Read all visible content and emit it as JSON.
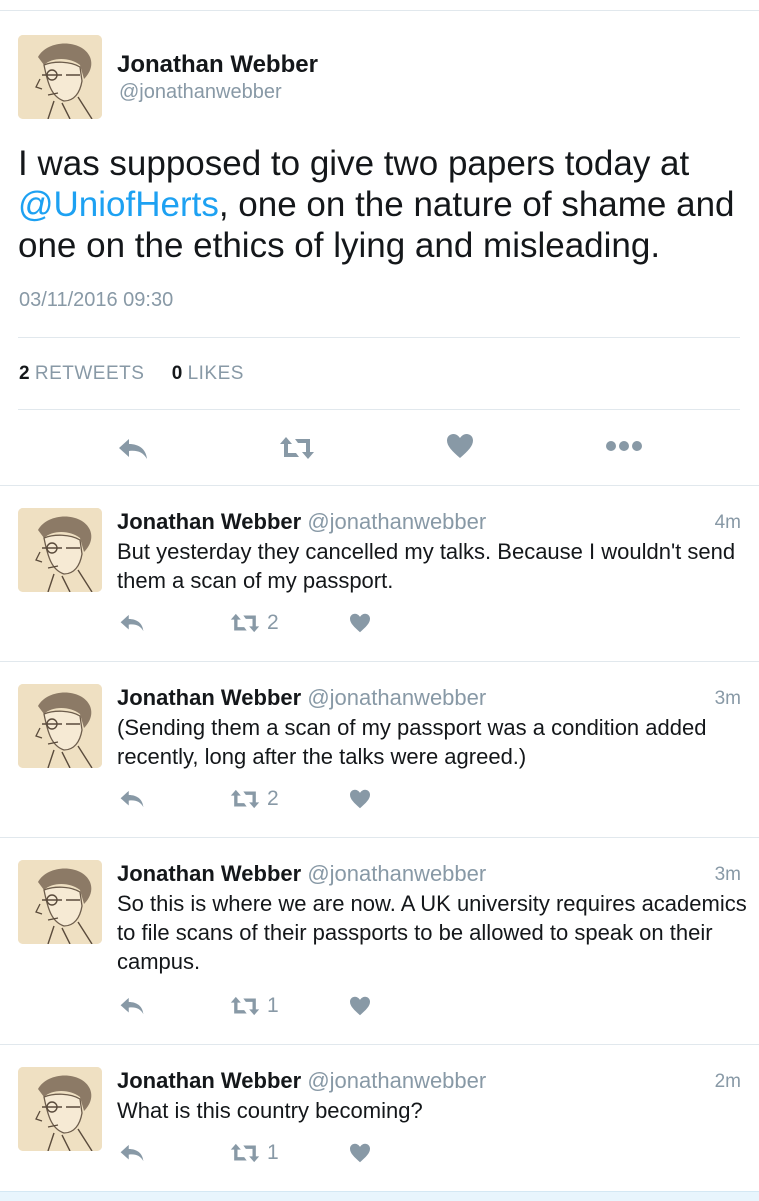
{
  "main_tweet": {
    "name": "Jonathan Webber",
    "handle": "@jonathanwebber",
    "text_before": "I was supposed to give two papers today at ",
    "mention": "@UniofHerts",
    "text_after": ", one on the nature of shame and one on the ethics of lying and misleading.",
    "date": "03/11/2016 09:30",
    "retweets_count": "2",
    "retweets_label": "RETWEETS",
    "likes_count": "0",
    "likes_label": "LIKES"
  },
  "replies": [
    {
      "name": "Jonathan Webber",
      "handle": "@jonathanwebber",
      "time": "4m",
      "text": "But yesterday they cancelled my talks. Because I wouldn't send them a scan of my passport.",
      "retweets": "2"
    },
    {
      "name": "Jonathan Webber",
      "handle": "@jonathanwebber",
      "time": "3m",
      "text": "(Sending them a scan of my passport was a condition added recently, long after the talks were agreed.)",
      "retweets": "2"
    },
    {
      "name": "Jonathan Webber",
      "handle": "@jonathanwebber",
      "time": "3m",
      "text": "So this is where we are now. A UK university requires academics to file scans of their passports to be allowed to speak on their campus.",
      "retweets": "1"
    },
    {
      "name": "Jonathan Webber",
      "handle": "@jonathanwebber",
      "time": "2m",
      "text": "What is this country becoming?",
      "retweets": "1"
    }
  ],
  "icons": {
    "reply": "reply-icon",
    "retweet": "retweet-icon",
    "like": "heart-icon",
    "more": "more-icon"
  },
  "colors": {
    "mention": "#1da1f2",
    "icon": "#8899a6",
    "secondary_text": "#8899a6"
  }
}
